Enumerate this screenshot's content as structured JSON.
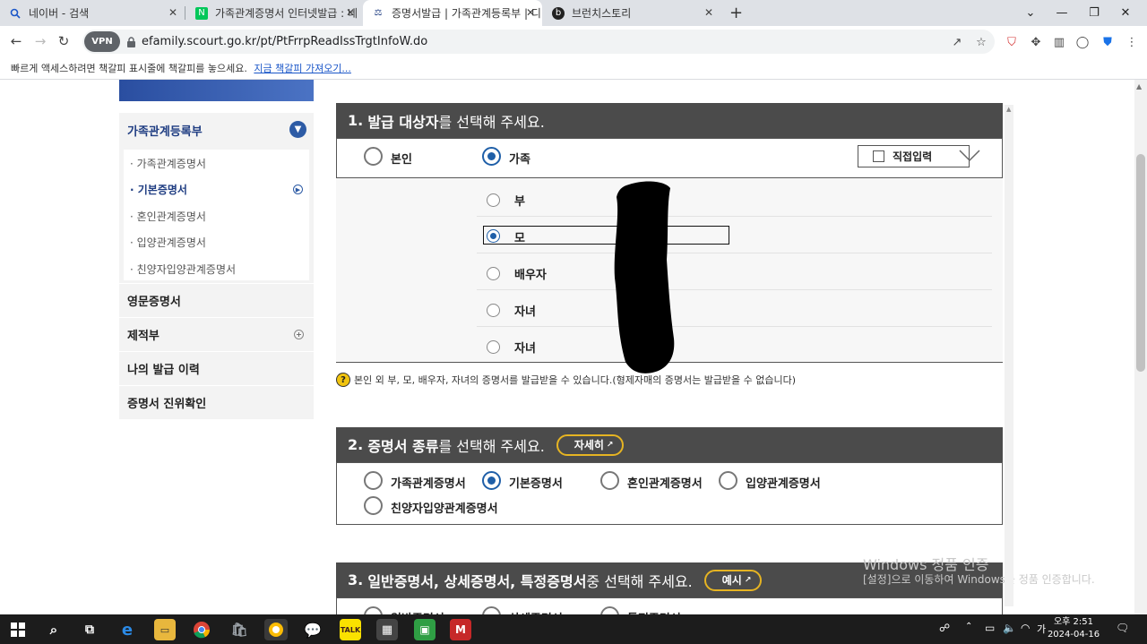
{
  "browser": {
    "tabs": [
      {
        "title": "네이버 - 검색",
        "icon": "search-icon"
      },
      {
        "title": "가족관계증명서 인터넷발급 : 네",
        "icon": "naver-icon"
      },
      {
        "title": "증명서발급 | 가족관계등록부 | 디",
        "icon": "court-icon"
      },
      {
        "title": "브런치스토리",
        "icon": "brunch-icon"
      }
    ],
    "url": "efamily.scourt.go.kr/pt/PtFrrpReadIssTrgtInfoW.do",
    "vpn_label": "VPN",
    "bookmark_hint": "빠르게 액세스하려면 책갈피 표시줄에 책갈피를 놓으세요.",
    "bookmark_link": "지금 책갈피 가져오기..."
  },
  "sidebar": {
    "section_title": "가족관계등록부",
    "sub_items": [
      {
        "label": "· 가족관계증명서",
        "selected": false
      },
      {
        "label": "· 기본증명서",
        "selected": true
      },
      {
        "label": "· 혼인관계증명서",
        "selected": false
      },
      {
        "label": "· 입양관계증명서",
        "selected": false
      },
      {
        "label": "· 친양자입양관계증명서",
        "selected": false
      }
    ],
    "menus": [
      {
        "label": "영문증명서",
        "has_plus": false
      },
      {
        "label": "제적부",
        "has_plus": true
      },
      {
        "label": "나의 발급 이력",
        "has_plus": false
      },
      {
        "label": "증명서 진위확인",
        "has_plus": false
      }
    ]
  },
  "section1": {
    "title_num": "1.",
    "title_bold": "발급 대상자",
    "title_rest": "를 선택해 주세요.",
    "options": [
      {
        "label": "본인",
        "checked": false
      },
      {
        "label": "가족",
        "checked": true
      }
    ],
    "direct_input_label": "직접입력",
    "family_options": [
      {
        "label": "부",
        "checked": false
      },
      {
        "label": "모",
        "checked": true
      },
      {
        "label": "배우자",
        "checked": false
      },
      {
        "label": "자녀",
        "checked": false
      },
      {
        "label": "자녀",
        "checked": false
      }
    ],
    "note": "본인 외 부, 모, 배우자, 자녀의 증명서를 발급받을 수 있습니다.(형제자매의 증명서는 발급받을 수 없습니다)"
  },
  "section2": {
    "title_num": "2.",
    "title_bold": "증명서 종류",
    "title_rest": "를 선택해 주세요.",
    "detail_button": "자세히",
    "options": [
      {
        "label": "가족관계증명서",
        "checked": false
      },
      {
        "label": "기본증명서",
        "checked": true
      },
      {
        "label": "혼인관계증명서",
        "checked": false
      },
      {
        "label": "입양관계증명서",
        "checked": false
      },
      {
        "label": "친양자입양관계증명서",
        "checked": false
      }
    ]
  },
  "section3": {
    "title_num": "3.",
    "title_bold": "일반증명서, 상세증명서, 특정증명서",
    "title_rest": " 중 선택해 주세요.",
    "example_button": "예시",
    "options": [
      {
        "label": "일반증명서"
      },
      {
        "label": "상세증명서"
      },
      {
        "label": "특정증명서"
      }
    ]
  },
  "watermark": {
    "line1": "Windows 정품 인증",
    "line2": "[설정]으로 이동하여 Windows를 정품 인증합니다."
  },
  "taskbar": {
    "time": "오후 2:51",
    "date": "2024-04-16"
  },
  "colors": {
    "section_bar": "#4b4b4b",
    "accent_blue": "#1f5fa8",
    "pill_border": "#e6b422"
  }
}
